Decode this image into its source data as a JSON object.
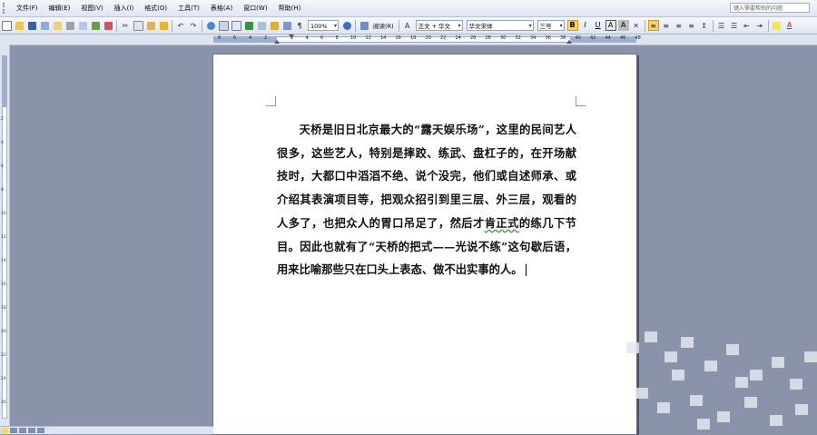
{
  "menubar": {
    "items": [
      "文件(F)",
      "编辑(E)",
      "视图(V)",
      "插入(I)",
      "格式(O)",
      "工具(T)",
      "表格(A)",
      "窗口(W)",
      "帮助(H)"
    ],
    "help_placeholder": "键入需要帮助的问题"
  },
  "toolbar": {
    "zoom": "100%",
    "read_label": "阅读(R)",
    "style": "正文 + 华文",
    "font": "华文宋体",
    "size": "三号",
    "bold": "B",
    "italic": "I",
    "underline": "U",
    "char_border": "A",
    "char_shade": "A",
    "font_color": "A"
  },
  "ruler": {
    "h_ticks_left": [
      "8",
      "6",
      "4",
      "2"
    ],
    "h_ticks_right": [
      "2",
      "4",
      "6",
      "8",
      "10",
      "12",
      "14",
      "16",
      "18",
      "20",
      "22",
      "24",
      "26",
      "28",
      "30",
      "32",
      "34",
      "36",
      "38",
      "40",
      "42",
      "44",
      "46",
      "48"
    ],
    "v_ticks": [
      "2",
      "4",
      "6",
      "8",
      "10",
      "12",
      "14",
      "16",
      "18",
      "20",
      "22",
      "24",
      "26"
    ]
  },
  "document": {
    "text_before": "天桥是旧日北京最大的“露天娱乐场”，这里的民间艺人很多，这些艺人，特别是摔跤、练武、盘杠子的，在开场献技时，大都口中滔滔不绝、说个没完，他们或自述师承、或介绍其表演项目等，把观众招引到里三层、外三层，观看的人多了，也把众人的胃口吊足了，然后才",
    "text_underlined": "肯正式",
    "text_after": "的练几下节目。因此也就有了“天桥的把式——光说不练”这句歇后语，用来比喻那些只在口头上表态、做不出实事的人。"
  },
  "colors": {
    "accent": "#ffd36b",
    "workspace": "#8a93aa"
  }
}
